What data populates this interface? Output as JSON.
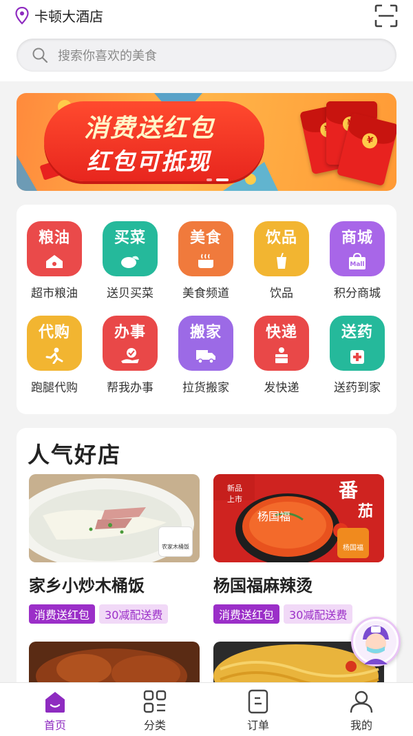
{
  "header": {
    "location": "卡顿大酒店",
    "search_placeholder": "搜索你喜欢的美食"
  },
  "banner": {
    "line1": "消费送红包",
    "line2": "红包可抵现",
    "coin_symbol": "¥",
    "accent": "#e8261e"
  },
  "categories": [
    {
      "icon_text": "粮油",
      "label": "超市粮油",
      "color": "#ea4a4a",
      "icon": "house-icon"
    },
    {
      "icon_text": "买菜",
      "label": "送贝买菜",
      "color": "#25b99b",
      "icon": "vegetable-icon"
    },
    {
      "icon_text": "美食",
      "label": "美食频道",
      "color": "#f07a3c",
      "icon": "pot-icon"
    },
    {
      "icon_text": "饮品",
      "label": "饮品",
      "color": "#f2b531",
      "icon": "drink-icon"
    },
    {
      "icon_text": "商城",
      "label": "积分商城",
      "color": "#a866e8",
      "icon": "mall-bag-icon",
      "sub": "Mall"
    },
    {
      "icon_text": "代购",
      "label": "跑腿代购",
      "color": "#f2b531",
      "icon": "runner-icon"
    },
    {
      "icon_text": "办事",
      "label": "帮我办事",
      "color": "#e94848",
      "icon": "helper-icon"
    },
    {
      "icon_text": "搬家",
      "label": "拉货搬家",
      "color": "#9c6ae6",
      "icon": "truck-icon"
    },
    {
      "icon_text": "快递",
      "label": "发快递",
      "color": "#e94848",
      "icon": "courier-icon"
    },
    {
      "icon_text": "送药",
      "label": "送药到家",
      "color": "#25b99b",
      "icon": "medicine-icon"
    }
  ],
  "popular": {
    "title": "人气好店",
    "shops": [
      {
        "name": "家乡小炒木桶饭",
        "tags": [
          "消费送红包",
          "30减配送费"
        ],
        "logo_text": "农家木桶饭"
      },
      {
        "name": "杨国福麻辣烫",
        "tags": [
          "消费送红包",
          "30减配送费"
        ],
        "logo_text": "杨国福",
        "img_text1": "新品",
        "img_text2": "上市",
        "img_text3": "番",
        "img_text4": "茄",
        "img_text5": "杨国福"
      }
    ]
  },
  "tabbar": [
    {
      "label": "首页",
      "icon": "home-icon",
      "active": true
    },
    {
      "label": "分类",
      "icon": "category-icon",
      "active": false
    },
    {
      "label": "订单",
      "icon": "order-icon",
      "active": false
    },
    {
      "label": "我的",
      "icon": "profile-icon",
      "active": false
    }
  ],
  "theme": {
    "primary": "#8e2bc0",
    "tag_bg": "#9b2fc8",
    "tag_light": "#f1d9f7"
  }
}
